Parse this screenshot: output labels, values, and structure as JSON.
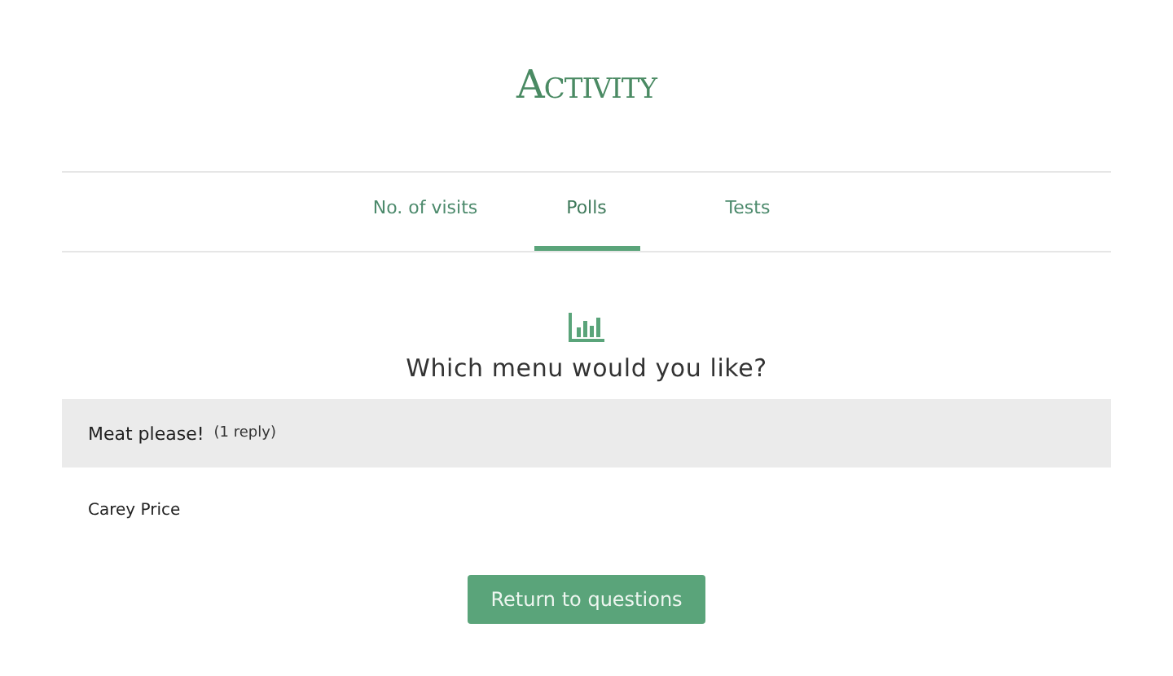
{
  "title": "Activity",
  "tabs": [
    {
      "label": "No. of visits",
      "selected": false
    },
    {
      "label": "Polls",
      "selected": true
    },
    {
      "label": "Tests",
      "selected": false
    }
  ],
  "poll": {
    "question": "Which menu would you like?",
    "answers": [
      {
        "label": "Meat please!",
        "count": "(1 reply)",
        "respondents": [
          "Carey Price"
        ]
      }
    ]
  },
  "button": "Return to questions"
}
